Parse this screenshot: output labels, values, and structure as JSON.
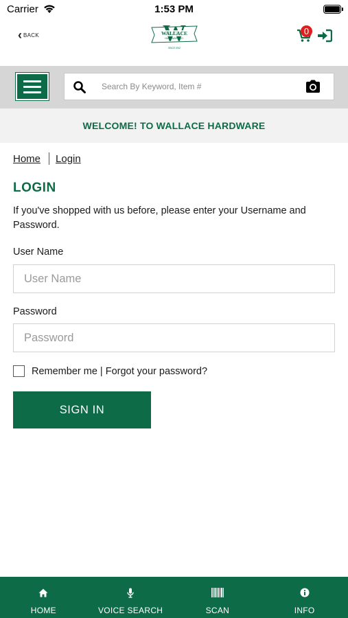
{
  "status_bar": {
    "carrier": "Carrier",
    "time": "1:53 PM"
  },
  "header": {
    "back_label": "BACK",
    "logo_name": "WALLACE",
    "logo_sub": "HARDWARE CO.",
    "logo_year": "SINCE 1942",
    "cart_count": "0"
  },
  "search": {
    "placeholder": "Search By Keyword, Item #"
  },
  "welcome": "WELCOME! TO WALLACE HARDWARE",
  "breadcrumb": {
    "home": "Home",
    "current": "Login"
  },
  "login": {
    "title": "LOGIN",
    "intro": "If you've shopped with us before, please enter your Username and Password.",
    "username_label": "User Name",
    "username_placeholder": "User Name",
    "password_label": "Password",
    "password_placeholder": "Password",
    "remember_label": "Remember me",
    "separator": "|",
    "forgot_label": "Forgot your password?",
    "signin_label": "SIGN IN"
  },
  "tabs": [
    {
      "label": "HOME",
      "icon": "home-icon"
    },
    {
      "label": "VOICE SEARCH",
      "icon": "microphone-icon"
    },
    {
      "label": "SCAN",
      "icon": "barcode-icon"
    },
    {
      "label": "INFO",
      "icon": "info-icon"
    }
  ],
  "colors": {
    "brand_green": "#0d6b47",
    "badge_red": "#e01e1e",
    "search_strip": "#d6d6d6",
    "welcome_bg": "#f2f2f2"
  }
}
